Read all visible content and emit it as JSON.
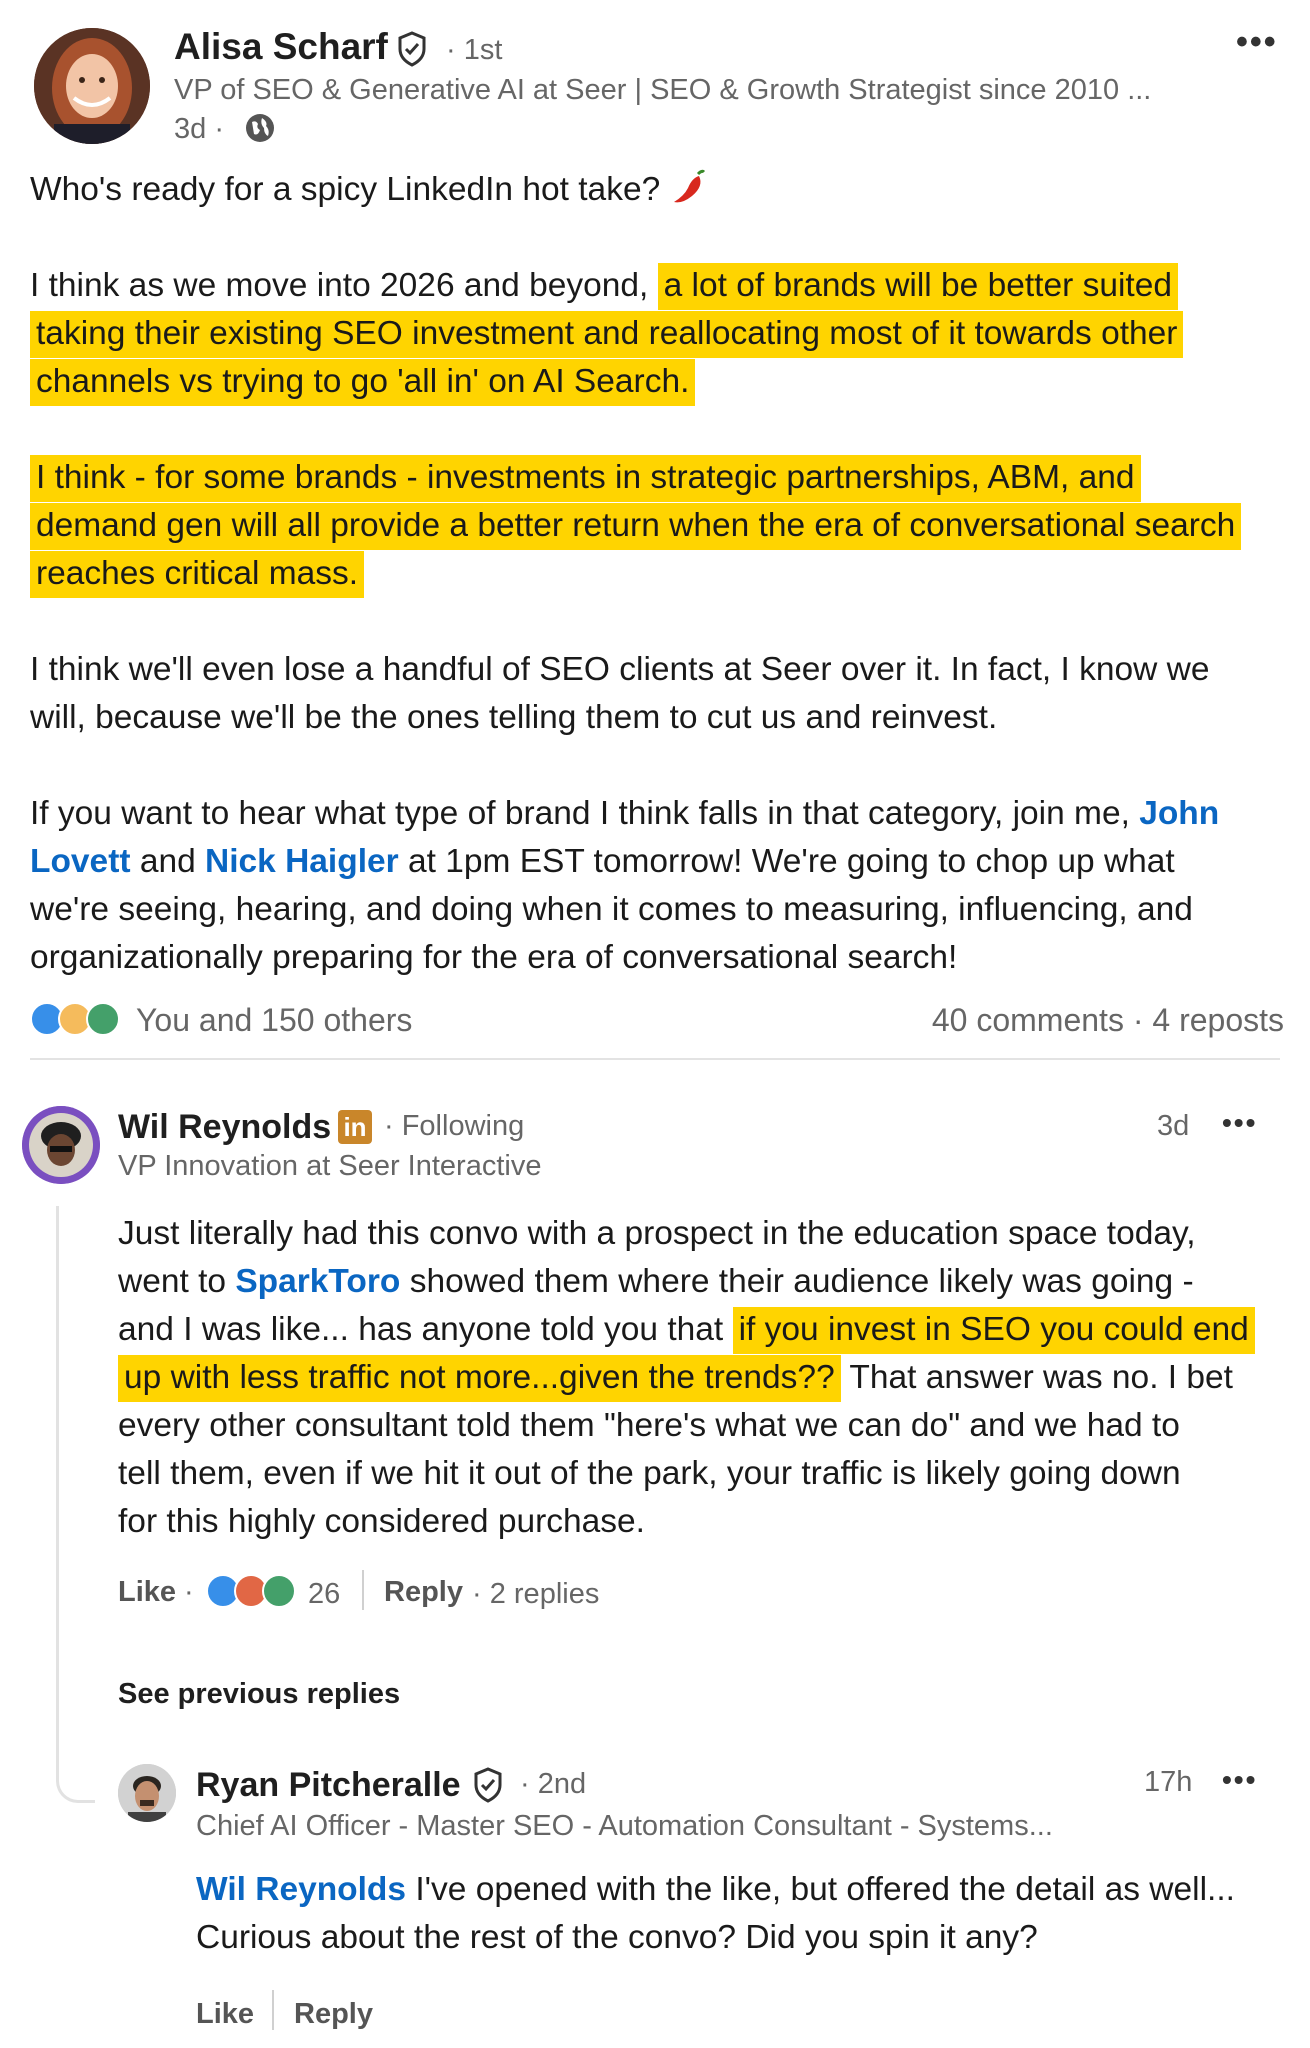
{
  "post": {
    "author": {
      "name": "Alisa Scharf",
      "connection": "1st",
      "headline": "VP of SEO & Generative AI at Seer | SEO & Growth Strategist since 2010 ...",
      "time": "3d"
    },
    "intro": "Who's ready for a spicy LinkedIn hot take?",
    "p2_plain": "I think as we move into 2026 and beyond,",
    "p2_hl_line1": "a lot of brands will be better suited",
    "p2_hl_line2": "taking their existing SEO investment and reallocating most of it towards other",
    "p2_hl_line3": "channels vs trying to go 'all in' on AI Search.",
    "p3_hl_line1": "I think - for some brands - investments in strategic partnerships, ABM, and",
    "p3_hl_line2": "demand gen will all provide a better return when the era of conversational search",
    "p3_hl_line3": "reaches critical mass.",
    "p4_line1": "I think we'll even lose a handful of SEO clients at Seer over it. In fact, I know we",
    "p4_line2": "will, because we'll be the ones telling them to cut us and reinvest.",
    "p5_line1": "If you want to hear what type of brand I think falls in that category, join me,",
    "p5_mention1a": "John",
    "p5_mention1b": "Lovett",
    "p5_and": "and",
    "p5_mention2": "Nick Haigler",
    "p5_line2_rest": "at 1pm EST tomorrow! We're going to chop up what",
    "p5_line3": "we're seeing, hearing, and doing when it comes to measuring, influencing, and",
    "p5_line4": "organizationally preparing for the era of conversational search!",
    "reactions_text": "You and 150 others",
    "stats": "40 comments · 4 reposts"
  },
  "comment1": {
    "name": "Wil Reynolds",
    "badge": "in",
    "status": "Following",
    "headline": "VP Innovation at Seer Interactive",
    "time": "3d",
    "line1": "Just literally had this convo with a prospect in the education space today,",
    "line2_a": "went to",
    "line2_link": "SparkToro",
    "line2_b": "showed them where their audience likely was going -",
    "line3_plain": "and I was like... has anyone told you that",
    "line3_hl": "if you invest in SEO you could end",
    "line4_hl": "up with less traffic not more...given the trends??",
    "line4_plain": "That answer was no. I bet",
    "line5": "every other consultant told them \"here's what we can do\" and we had to",
    "line6": "tell them, even if we hit it out of the park, your traffic is likely going down",
    "line7": "for this highly considered purchase.",
    "like": "Like",
    "reaction_count": "26",
    "reply": "Reply",
    "replies": "2 replies",
    "see_previous": "See previous replies"
  },
  "reply1": {
    "name": "Ryan Pitcheralle",
    "connection": "2nd",
    "headline": "Chief AI Officer - Master SEO - Automation Consultant - Systems...",
    "time": "17h",
    "mention": "Wil Reynolds",
    "line1_rest": "I've opened with the like, but offered the detail as well...",
    "line2": "Curious about the rest of the convo? Did you spin it any?",
    "like": "Like",
    "reply": "Reply"
  },
  "colors": {
    "highlight": "#ffd400",
    "link": "#0a66c2",
    "linkedin": "#c9862a"
  }
}
